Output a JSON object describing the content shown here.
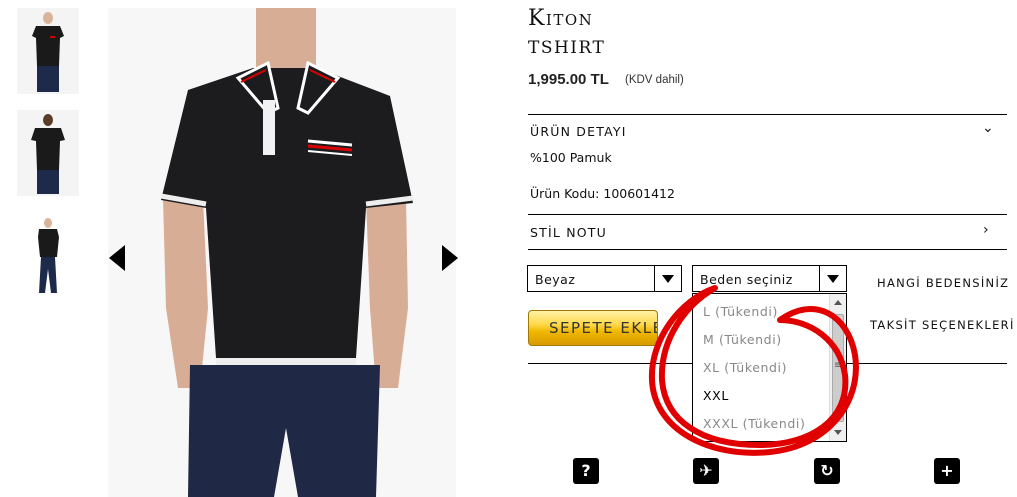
{
  "product": {
    "brand": "Kiton",
    "type": "TSHIRT",
    "price": "1,995.00 TL",
    "vat_note": "(KDV dahil)"
  },
  "detail": {
    "title": "ÜRÜN DETAYI",
    "material": "%100 Pamuk",
    "code_text": "Ürün Kodu: 100601412"
  },
  "style_note": {
    "title": "STİL NOTU"
  },
  "color_select": {
    "value": "Beyaz"
  },
  "size_select": {
    "placeholder": "Beden seçiniz",
    "options": [
      {
        "label": "L (Tükendi)",
        "available": false
      },
      {
        "label": "M (Tükendi)",
        "available": false
      },
      {
        "label": "XL (Tükendi)",
        "available": false
      },
      {
        "label": "XXL",
        "available": true
      },
      {
        "label": "XXXL (Tükendi)",
        "available": false
      }
    ]
  },
  "links": {
    "size_guide": "HANGİ BEDENSİNİZ",
    "installments": "TAKSİT SEÇENEKLERİ"
  },
  "cart_button": {
    "label": "SEPETE EKLE"
  },
  "bottom_icons": [
    "question-icon",
    "plane-icon",
    "refresh-icon",
    "plus-icon"
  ],
  "bottom_icon_glyphs": [
    "?",
    "✈",
    "↻",
    "+"
  ],
  "colors": {
    "annotation": "#e00000",
    "cart_gold": "#f0b800"
  }
}
